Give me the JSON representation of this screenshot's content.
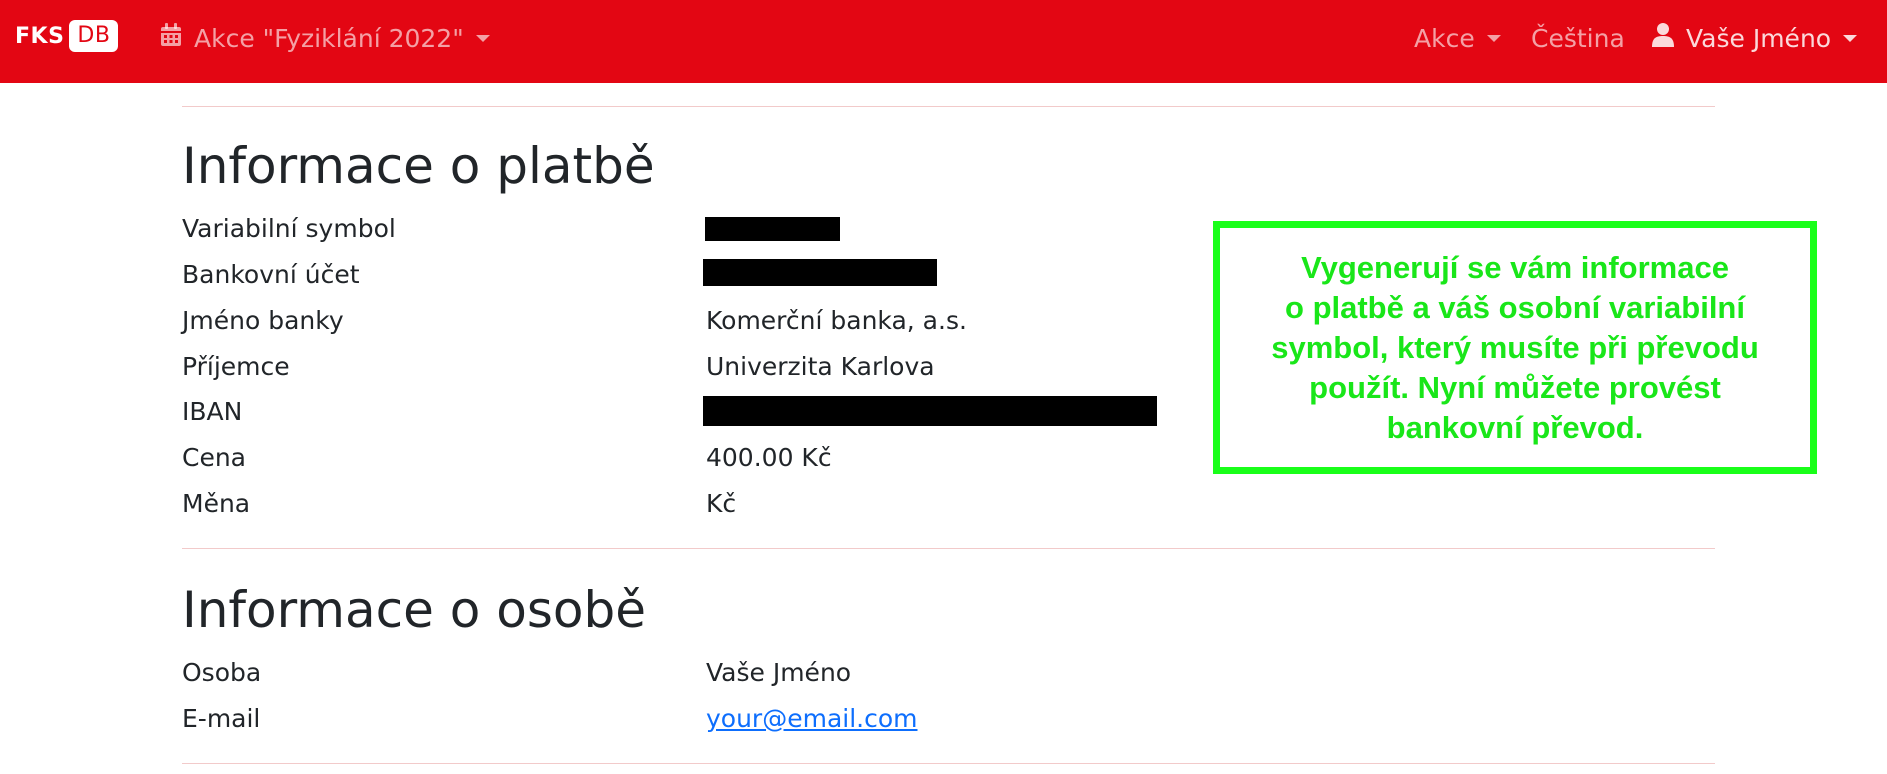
{
  "navbar": {
    "brand_main": "FKS",
    "brand_badge": "DB",
    "event_selector": "Akce \"Fyziklání 2022\"",
    "menu_akce": "Akce",
    "language": "Čeština",
    "user": "Vaše Jméno"
  },
  "icons": {
    "calendar": "calendar-icon",
    "user": "user-icon",
    "caret": "chevron-down-icon"
  },
  "colors": {
    "navbar": "#e30613",
    "callout_border": "#19ff19",
    "callout_text": "#19e619",
    "link": "#0d6efd"
  },
  "payment": {
    "heading": "Informace o platbě",
    "rows": [
      {
        "label": "Variabilní symbol",
        "value": ""
      },
      {
        "label": "Bankovní účet",
        "value": ""
      },
      {
        "label": "Jméno banky",
        "value": "Komerční banka, a.s."
      },
      {
        "label": "Příjemce",
        "value": "Univerzita Karlova"
      },
      {
        "label": "IBAN",
        "value": ""
      },
      {
        "label": "Cena",
        "value": "400.00 Kč"
      },
      {
        "label": "Měna",
        "value": "Kč"
      }
    ]
  },
  "person": {
    "heading": "Informace o osobě",
    "rows": [
      {
        "label": "Osoba",
        "value": "Vaše Jméno"
      },
      {
        "label": "E-mail",
        "value": "your@email.com"
      }
    ]
  },
  "callout": {
    "lines": [
      "Vygenerují se vám informace",
      "o platbě a váš osobní variabilní",
      "symbol, který musíte při převodu",
      "použít. Nyní můžete provést",
      "bankovní převod."
    ]
  }
}
